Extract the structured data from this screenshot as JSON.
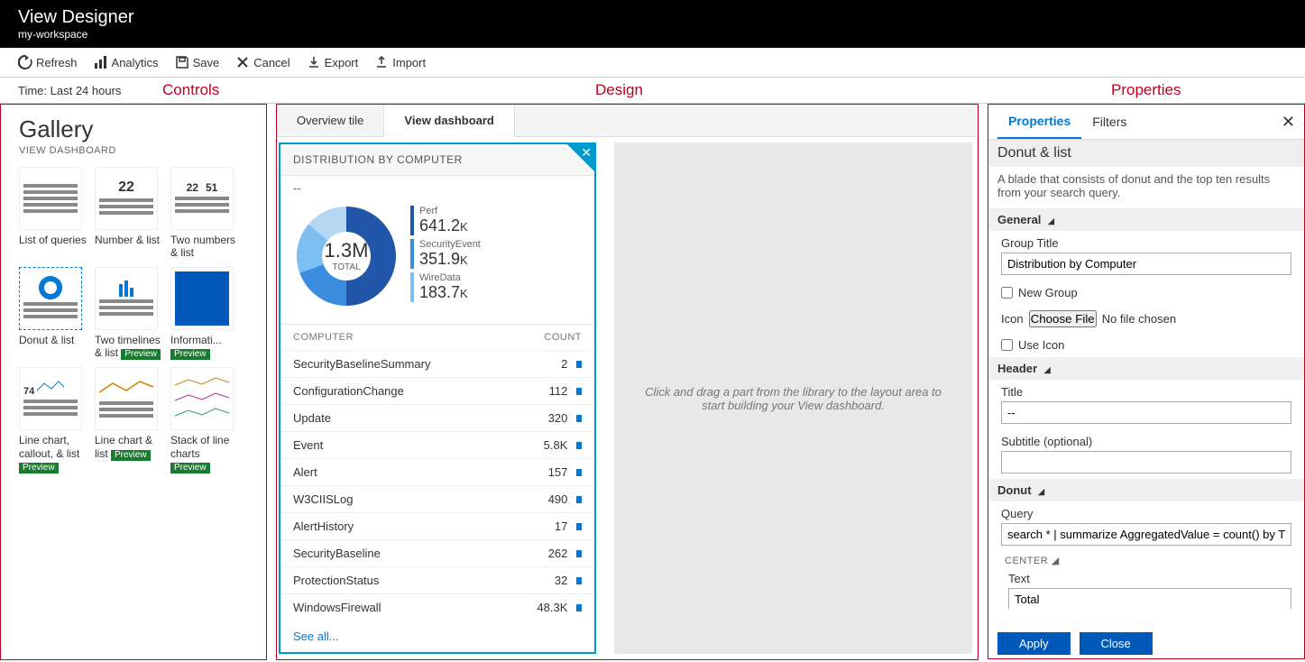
{
  "header": {
    "title": "View Designer",
    "subtitle": "my-workspace"
  },
  "toolbar": {
    "refresh": "Refresh",
    "analytics": "Analytics",
    "save": "Save",
    "cancel": "Cancel",
    "export": "Export",
    "import": "Import"
  },
  "time_label": "Time: Last 24 hours",
  "annotations": {
    "controls": "Controls",
    "design": "Design",
    "properties": "Properties"
  },
  "gallery": {
    "title": "Gallery",
    "subtitle": "VIEW DASHBOARD",
    "items": [
      {
        "name": "List of queries",
        "preview": false
      },
      {
        "name": "Number & list",
        "preview": false,
        "num1": "22"
      },
      {
        "name": "Two numbers & list",
        "preview": false,
        "num1": "22",
        "num2": "51"
      },
      {
        "name": "Donut & list",
        "preview": false,
        "selected": true
      },
      {
        "name": "Two timelines & list",
        "preview": true
      },
      {
        "name": "Informati...",
        "preview": true
      },
      {
        "name": "Line chart, callout, & list",
        "preview": true,
        "callout": "74"
      },
      {
        "name": "Line chart & list",
        "preview": true
      },
      {
        "name": "Stack of line charts",
        "preview": true
      }
    ]
  },
  "design": {
    "tabs": {
      "overview": "Overview tile",
      "dashboard": "View dashboard"
    },
    "tile": {
      "title": "DISTRIBUTION BY COMPUTER",
      "subtitle": "--",
      "donut": {
        "total": "1.3M",
        "total_label": "TOTAL"
      },
      "legend": [
        {
          "label": "Perf",
          "value": "641.2",
          "unit": "K",
          "color": "#2256a8"
        },
        {
          "label": "SecurityEvent",
          "value": "351.9",
          "unit": "K",
          "color": "#3a8dde"
        },
        {
          "label": "WireData",
          "value": "183.7",
          "unit": "K",
          "color": "#7fbef0"
        }
      ],
      "table": {
        "col1": "COMPUTER",
        "col2": "COUNT",
        "rows": [
          {
            "name": "SecurityBaselineSummary",
            "count": "2"
          },
          {
            "name": "ConfigurationChange",
            "count": "112"
          },
          {
            "name": "Update",
            "count": "320"
          },
          {
            "name": "Event",
            "count": "5.8K"
          },
          {
            "name": "Alert",
            "count": "157"
          },
          {
            "name": "W3CIISLog",
            "count": "490"
          },
          {
            "name": "AlertHistory",
            "count": "17"
          },
          {
            "name": "SecurityBaseline",
            "count": "262"
          },
          {
            "name": "ProtectionStatus",
            "count": "32"
          },
          {
            "name": "WindowsFirewall",
            "count": "48.3K"
          }
        ],
        "see_all": "See all..."
      }
    },
    "dropzone": "Click and drag a part from the library to the layout area to start building your View dashboard."
  },
  "props": {
    "tabs": {
      "properties": "Properties",
      "filters": "Filters"
    },
    "title": "Donut & list",
    "desc": "A blade that consists of donut and the top ten results from your search query.",
    "general": {
      "heading": "General",
      "group_title_label": "Group Title",
      "group_title_value": "Distribution by Computer",
      "new_group": "New Group",
      "icon_label": "Icon",
      "choose_file": "Choose File",
      "no_file": "No file chosen",
      "use_icon": "Use Icon"
    },
    "header": {
      "heading": "Header",
      "title_label": "Title",
      "title_value": "--",
      "subtitle_label": "Subtitle (optional)",
      "subtitle_value": ""
    },
    "donut": {
      "heading": "Donut",
      "query_label": "Query",
      "query_value": "search * | summarize AggregatedValue = count() by T",
      "center_label": "CENTER",
      "text_label": "Text",
      "text_value": "Total"
    },
    "buttons": {
      "apply": "Apply",
      "close": "Close"
    }
  }
}
